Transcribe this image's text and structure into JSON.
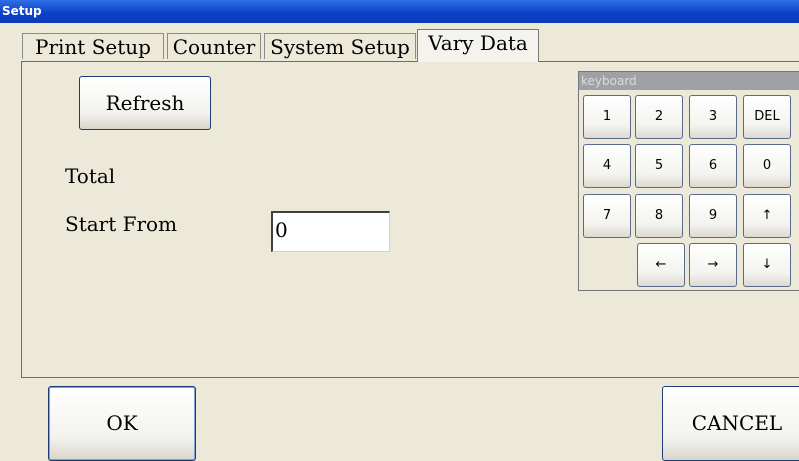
{
  "window": {
    "title": "Setup"
  },
  "tabs": [
    {
      "label": "Print Setup"
    },
    {
      "label": "Counter"
    },
    {
      "label": "System Setup"
    },
    {
      "label": "Vary Data",
      "active": true
    }
  ],
  "vary_data": {
    "refresh_label": "Refresh",
    "total_label": "Total",
    "start_from_label": "Start From",
    "start_from_value": "0"
  },
  "keyboard": {
    "title": "keyboard",
    "keys": [
      "1",
      "2",
      "3",
      "DEL",
      "4",
      "5",
      "6",
      "0",
      "7",
      "8",
      "9",
      "↑",
      "←",
      "→",
      "↓"
    ]
  },
  "footer": {
    "ok_label": "OK",
    "cancel_label": "CANCEL"
  }
}
